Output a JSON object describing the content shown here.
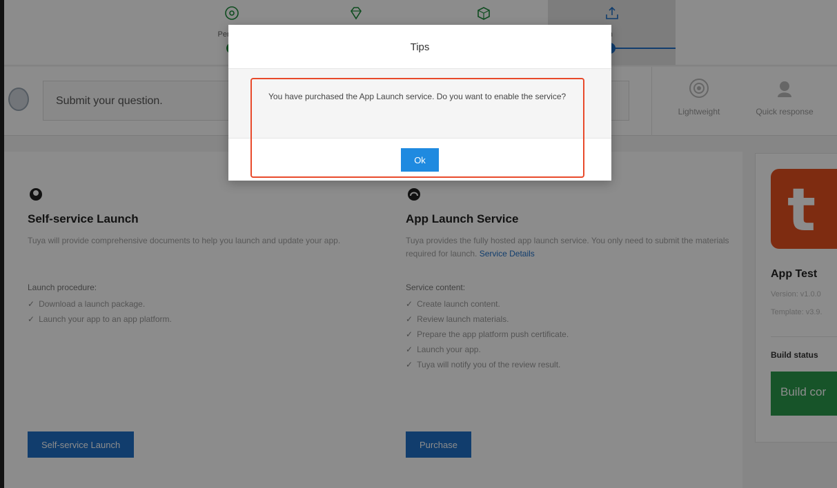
{
  "steps": [
    {
      "label": "Persona",
      "icon": "gear-circle-icon",
      "state": "done"
    },
    {
      "label": "",
      "icon": "diamond-icon",
      "state": "done"
    },
    {
      "label": "",
      "icon": "package-icon",
      "state": "done"
    },
    {
      "label": "nch",
      "icon": "tray-upload-icon",
      "state": "active"
    }
  ],
  "question": {
    "placeholder": "Submit your question.",
    "features": [
      {
        "label": "Lightweight",
        "icon": "target-icon"
      },
      {
        "label": "Quick response",
        "icon": "support-agent-icon"
      }
    ]
  },
  "self_service": {
    "title": "Self-service Launch",
    "description": "Tuya will provide comprehensive documents to help you launch and update your app.",
    "list_header": "Launch procedure:",
    "items": [
      "Download a launch package.",
      "Launch your app to an app platform."
    ],
    "button": "Self-service Launch"
  },
  "app_launch": {
    "title": "App Launch Service",
    "description": "Tuya provides the fully hosted app launch service. You only need to submit the materials required for launch.",
    "link": "Service Details",
    "list_header": "Service content:",
    "items": [
      "Create launch content.",
      "Review launch materials.",
      "Prepare the app platform push certificate.",
      "Launch your app.",
      "Tuya will notify you of the review result."
    ],
    "button": "Purchase"
  },
  "app_card": {
    "logo_letter": "t",
    "name": "App Test",
    "version": "Version: v1.0.0",
    "template": "Template: v3.9.",
    "build_status_label": "Build status",
    "build_button": "Build cor"
  },
  "modal": {
    "title": "Tips",
    "message": "You have purchased the App Launch service. Do you want to enable the service?",
    "ok_label": "Ok"
  },
  "colors": {
    "accent": "#1f6fc6",
    "success": "#2b9a4b",
    "highlight": "#e8492a",
    "logo": "#e5511f"
  }
}
